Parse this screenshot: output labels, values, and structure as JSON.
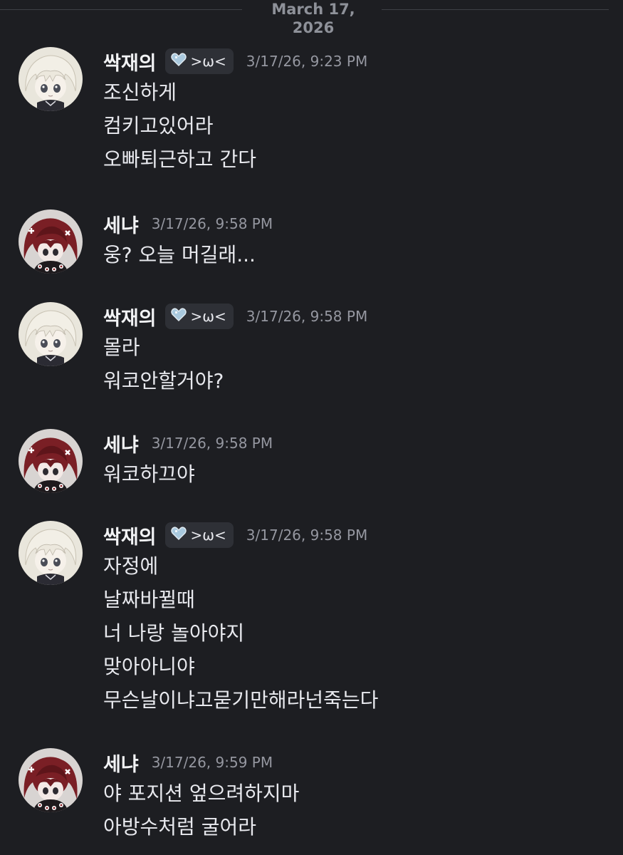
{
  "divider": {
    "date": "March 17, 2026"
  },
  "messages": [
    {
      "author": "싹재의",
      "tag": ">ω<",
      "time": "3/17/26, 9:23 PM",
      "lines": [
        "조신하게",
        "컴키고있어라",
        "오빠퇴근하고 간다"
      ]
    },
    {
      "author": "세냐",
      "time": "3/17/26, 9:58 PM",
      "lines": [
        "웅? 오늘 머길래..."
      ]
    },
    {
      "author": "싹재의",
      "tag": ">ω<",
      "time": "3/17/26, 9:58 PM",
      "lines": [
        "몰라",
        "워코안할거야?"
      ]
    },
    {
      "author": "세냐",
      "time": "3/17/26, 9:58 PM",
      "lines": [
        "워코하끄야"
      ]
    },
    {
      "author": "싹재의",
      "tag": ">ω<",
      "time": "3/17/26, 9:58 PM",
      "lines": [
        "자정에",
        "날짜바뀔때",
        "너 나랑 놀아야지",
        "맞아아니야",
        "무슨날이냐고묻기만해라넌죽는다"
      ]
    },
    {
      "author": "세냐",
      "time": "3/17/26, 9:59 PM",
      "lines": [
        "야 포지션 엎으려하지마",
        "아방수처럼 굴어라"
      ]
    }
  ],
  "colors": {
    "background": "#1d1e22",
    "tag_bg": "#2e3036",
    "timestamp": "#9597a0",
    "heart": "#a9c9de"
  },
  "icons": {
    "tag": "heart-icon"
  }
}
